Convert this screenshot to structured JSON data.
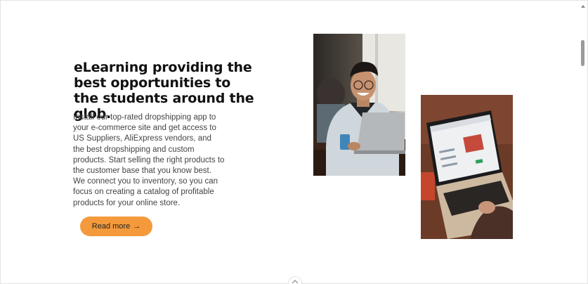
{
  "hero": {
    "headline": "eLearning providing the best opportunities to the students around the glob.",
    "description": "Install our top-rated dropshipping app to your e-commerce site and get access to US Suppliers, AliExpress vendors, and the best dropshipping and custom products. Start selling the right products to the customer base that you know best. We connect you to inventory, so you can focus on creating a catalog of profitable products for your online store.",
    "read_more_label": "Read more",
    "read_more_arrow": "→"
  },
  "images": {
    "photo_1": "smiling-student-with-laptop-photo",
    "photo_2": "laptop-on-desk-photo"
  },
  "colors": {
    "accent": "#f49a3c",
    "heading": "#111111",
    "body": "#444444"
  }
}
